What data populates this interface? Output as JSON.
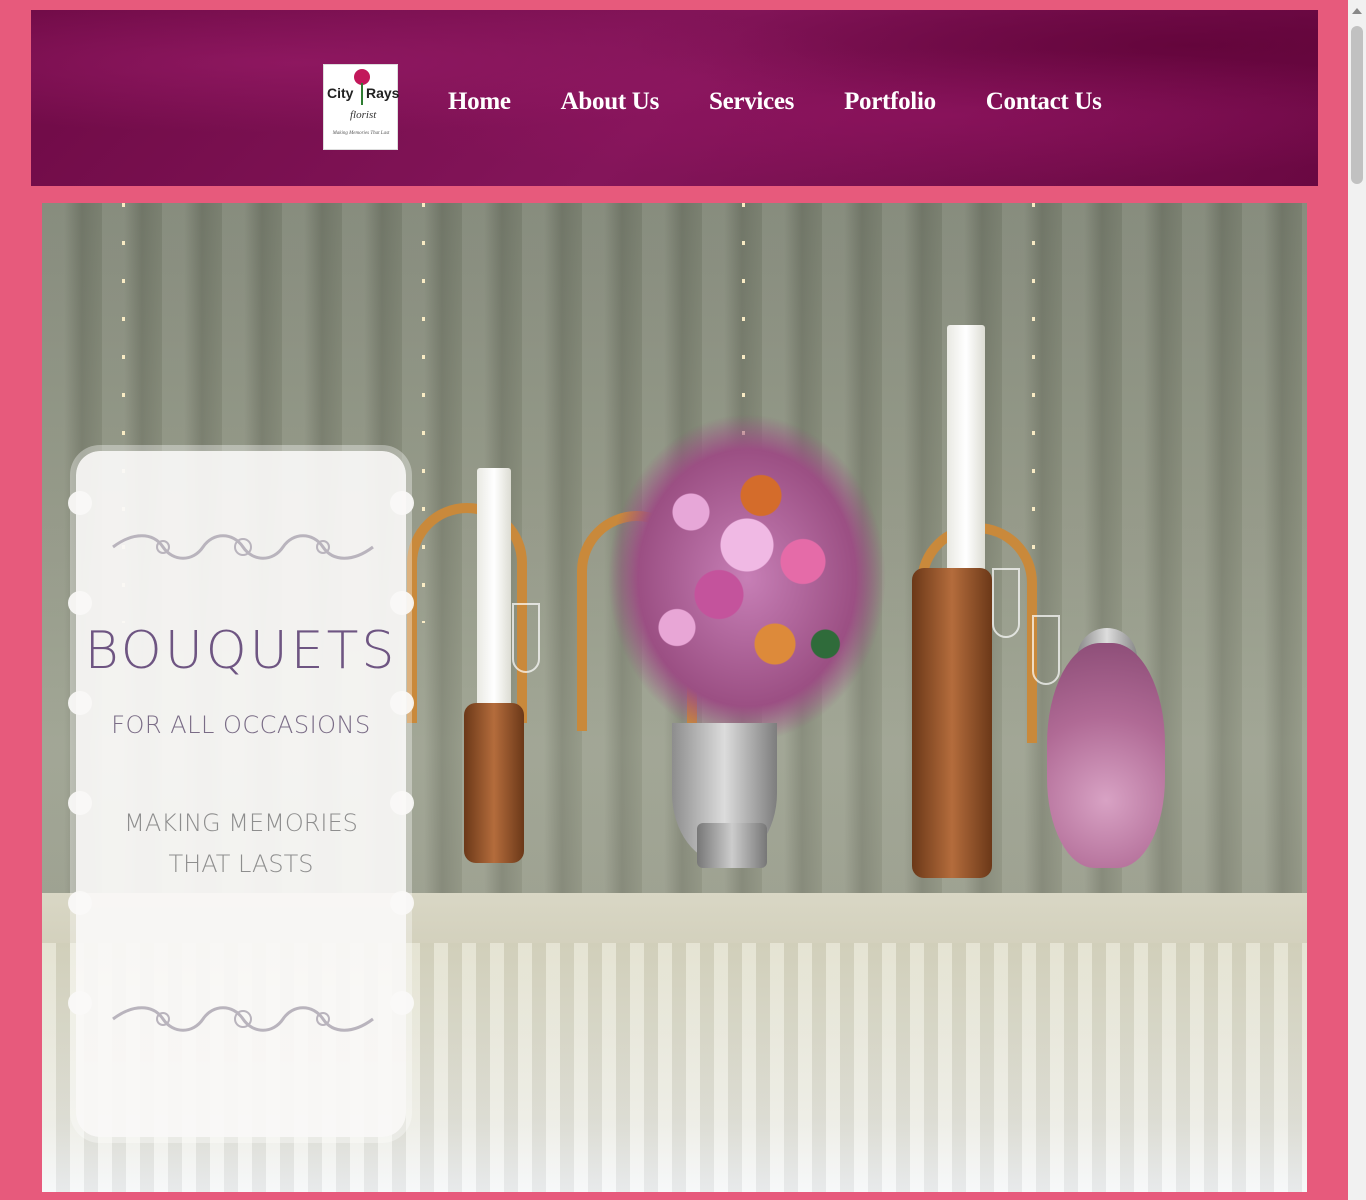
{
  "site": {
    "logo": {
      "brand_left": "City",
      "brand_right": "Rays",
      "subtitle": "florist",
      "tagline": "Making Memories That Last"
    }
  },
  "nav": {
    "items": [
      {
        "label": "Home"
      },
      {
        "label": "About Us"
      },
      {
        "label": "Services"
      },
      {
        "label": "Portfolio"
      },
      {
        "label": "Contact Us"
      }
    ]
  },
  "hero": {
    "title": "BOUQUETS",
    "subtitle": "FOR ALL OCCASIONS",
    "tagline_line1": "MAKING MEMORIES",
    "tagline_line2": "THAT LASTS"
  },
  "colors": {
    "page_background": "#e75a7c",
    "header_background": "#7a0f4f",
    "nav_text": "#ffffff",
    "title_text": "#6e5582"
  }
}
